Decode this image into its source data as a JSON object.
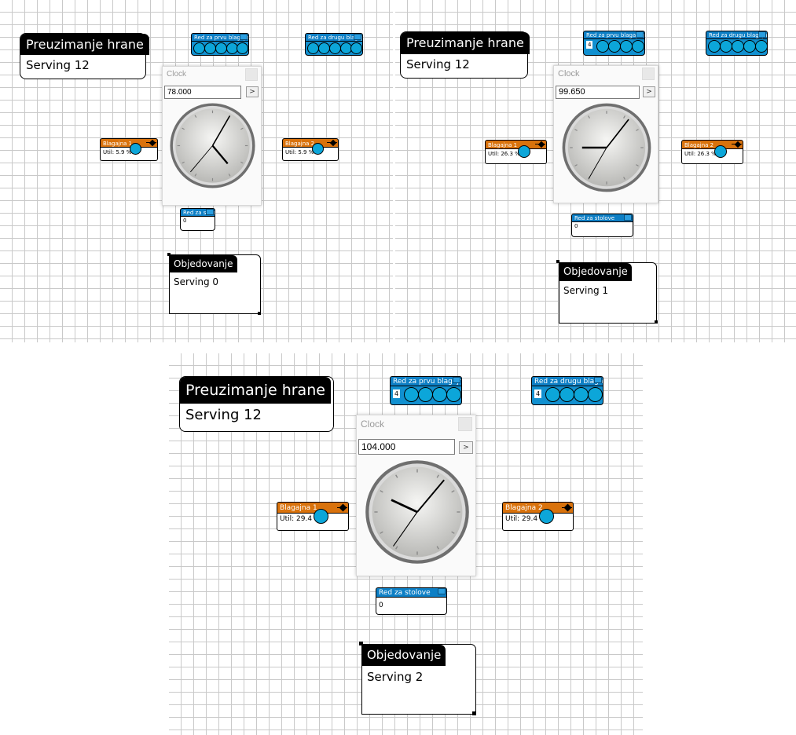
{
  "snapshots": [
    {
      "clock": {
        "title": "Clock",
        "time": "78.000",
        "go_label": ">",
        "hour_angle": 140,
        "minute_angle": 30,
        "second_angle": 220
      },
      "food_station": {
        "title": "Preuzimanje hrane",
        "serving": "Serving 12"
      },
      "queue1": {
        "title": "Red za prvu blagajnu",
        "count": ""
      },
      "queue2": {
        "title": "Red za drugu blagajnu",
        "count": ""
      },
      "cashier1": {
        "title": "Blagajna 1",
        "util": "Util: 5.9 %"
      },
      "cashier2": {
        "title": "Blagajna 2",
        "util": "Util: 5.9 %"
      },
      "table_queue": {
        "title": "Red za stolove",
        "count": "0"
      },
      "dining": {
        "title": "Objedovanje",
        "serving": "Serving 0"
      }
    },
    {
      "clock": {
        "title": "Clock",
        "time": "99.650",
        "go_label": ">",
        "hour_angle": 270,
        "minute_angle": 38,
        "second_angle": 210
      },
      "food_station": {
        "title": "Preuzimanje hrane",
        "serving": "Serving 12"
      },
      "queue1": {
        "title": "Red za prvu blagajnu",
        "count": "4"
      },
      "queue2": {
        "title": "Red za drugu blagajnu",
        "count": ""
      },
      "cashier1": {
        "title": "Blagajna 1",
        "util": "Util: 26.3 %"
      },
      "cashier2": {
        "title": "Blagajna 2",
        "util": "Util: 26.3 %"
      },
      "table_queue": {
        "title": "Red za stolove",
        "count": "0"
      },
      "dining": {
        "title": "Objedovanje",
        "serving": "Serving 1"
      }
    },
    {
      "clock": {
        "title": "Clock",
        "time": "104.000",
        "go_label": ">",
        "hour_angle": 295,
        "minute_angle": 40,
        "second_angle": 215
      },
      "food_station": {
        "title": "Preuzimanje hrane",
        "serving": "Serving 12"
      },
      "queue1": {
        "title": "Red za prvu blagajnu",
        "count": "4"
      },
      "queue2": {
        "title": "Red za drugu blagajnu",
        "count": "4"
      },
      "cashier1": {
        "title": "Blagajna 1",
        "util": "Util: 29.4 %"
      },
      "cashier2": {
        "title": "Blagajna 2",
        "util": "Util: 29.4 %"
      },
      "table_queue": {
        "title": "Red za stolove",
        "count": "0"
      },
      "dining": {
        "title": "Objedovanje",
        "serving": "Serving 2"
      }
    }
  ],
  "colors": {
    "queue": "#0d7fc5",
    "entity": "#0ca6d9",
    "cashier": "#d9720c",
    "grid": "#c9c9c9"
  }
}
